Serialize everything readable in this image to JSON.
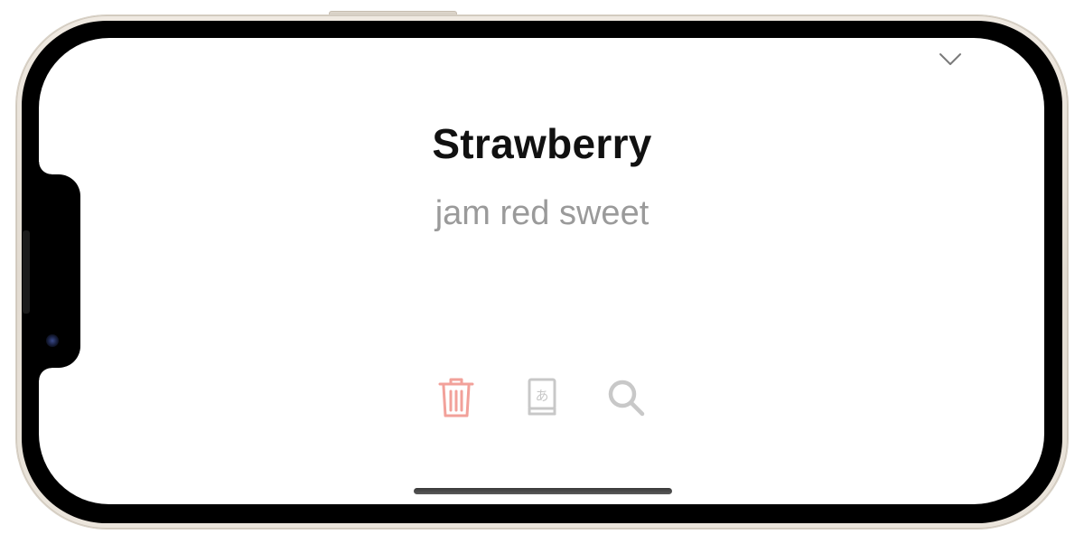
{
  "card": {
    "word": "Strawberry",
    "tags": "jam red sweet"
  },
  "icons": {
    "collapse": "chevron-down-icon",
    "delete": "trash-icon",
    "dictionary": "dictionary-book-icon",
    "search": "magnifying-glass-icon"
  },
  "colors": {
    "delete": "#f2a19a",
    "neutral_icon": "#c8c8c8",
    "title": "#111111",
    "tags": "#9a9a9a"
  }
}
